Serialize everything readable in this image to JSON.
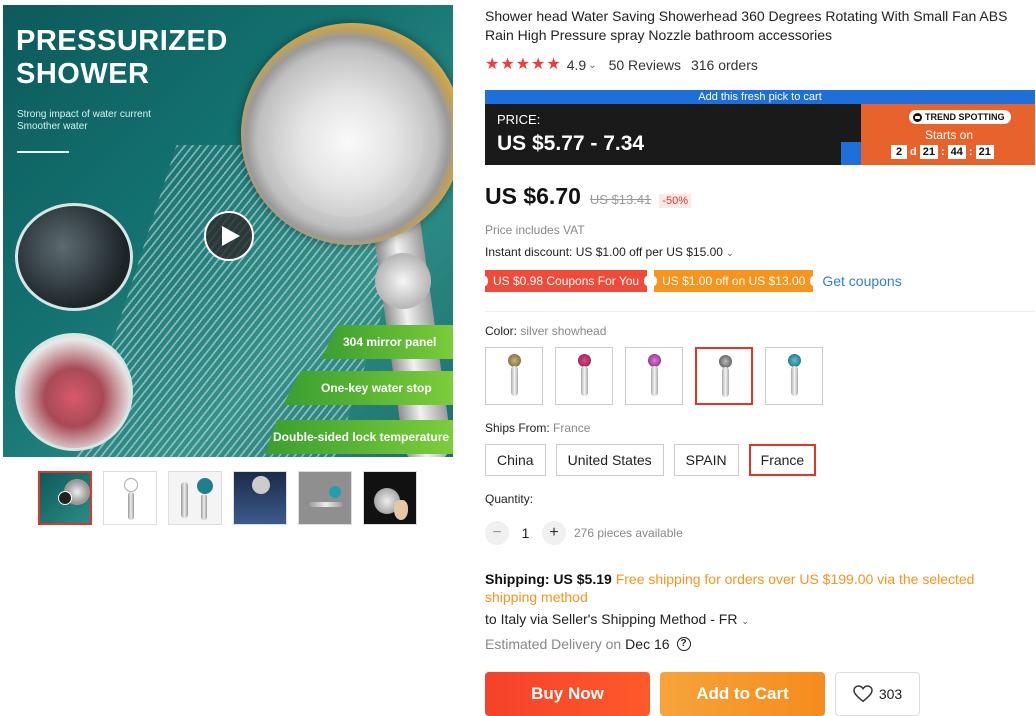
{
  "gallery": {
    "hero_title_line1": "PRESSURIZED",
    "hero_title_line2": "SHOWER",
    "hero_sub_line1": "Strong impact of water current",
    "hero_sub_line2": "Smoother water",
    "banner_1": "304 mirror panel",
    "banner_2": "One-key water stop",
    "banner_3": "Double-sided lock temperature",
    "play_icon": "play-icon",
    "selected_thumbnail": 1
  },
  "product": {
    "title": "Shower head Water Saving Showerhead 360 Degrees Rotating With Small Fan ABS Rain High Pressure spray Nozzle bathroom accessories",
    "rating": "4.9",
    "stars": 5,
    "reviews": "50 Reviews",
    "orders": "316 orders"
  },
  "promo": {
    "caption": "Add this fresh pick to cart",
    "price_label": "PRICE:",
    "price_value": "US $5.77 - 7.34",
    "trend_label": "TREND SPOTTING",
    "starts_on": "Starts on",
    "countdown": {
      "days": "2",
      "d": "d",
      "hours": "21",
      "minutes": "44",
      "seconds": "21"
    },
    "colors": {
      "dark": "#1a1a1a",
      "orange": "#e8632b",
      "blue": "#1e6fd9"
    }
  },
  "price": {
    "current": "US $6.70",
    "original": "US $13.41",
    "discount": "-50%",
    "vat_note": "Price includes VAT",
    "instant_discount": "Instant discount: US $1.00 off per US $15.00"
  },
  "coupons": {
    "coupon_1": "US $0.98 Coupons For You",
    "coupon_2": "US $1.00 off on US $13.00",
    "get_coupons": "Get coupons"
  },
  "color": {
    "label": "Color:",
    "selected": "silver showhead",
    "options": [
      {
        "name": "bronze-showhead",
        "hex": "#8a7a4c"
      },
      {
        "name": "red-showhead",
        "hex": "#b0265a"
      },
      {
        "name": "purple-showhead",
        "hex": "#b03aa8"
      },
      {
        "name": "silver-showhead",
        "hex": "#6f6f6f"
      },
      {
        "name": "teal-showhead",
        "hex": "#1f7f8f"
      }
    ],
    "selected_index": 3
  },
  "ships_from": {
    "label": "Ships From:",
    "selected": "France",
    "options": [
      "China",
      "United States",
      "SPAIN",
      "France"
    ],
    "selected_index": 3
  },
  "quantity": {
    "label": "Quantity:",
    "minus": "−",
    "plus": "+",
    "value": "1",
    "available": "276 pieces available"
  },
  "shipping": {
    "label": "Shipping: US $5.19",
    "free_note": "Free shipping for orders over US $199.00 via the selected shipping method",
    "destination": "to Italy via Seller's Shipping Method - FR",
    "eta_label": "Estimated Delivery on",
    "eta_date": "Dec 16",
    "help": "?"
  },
  "actions": {
    "buy_now": "Buy Now",
    "add_to_cart": "Add to Cart",
    "wishlist_count": "303"
  },
  "theme": {
    "accent_red": "#e0352b",
    "star_red": "#f23b3b",
    "orange": "#f7941d",
    "link_blue": "#2e7fd8"
  }
}
